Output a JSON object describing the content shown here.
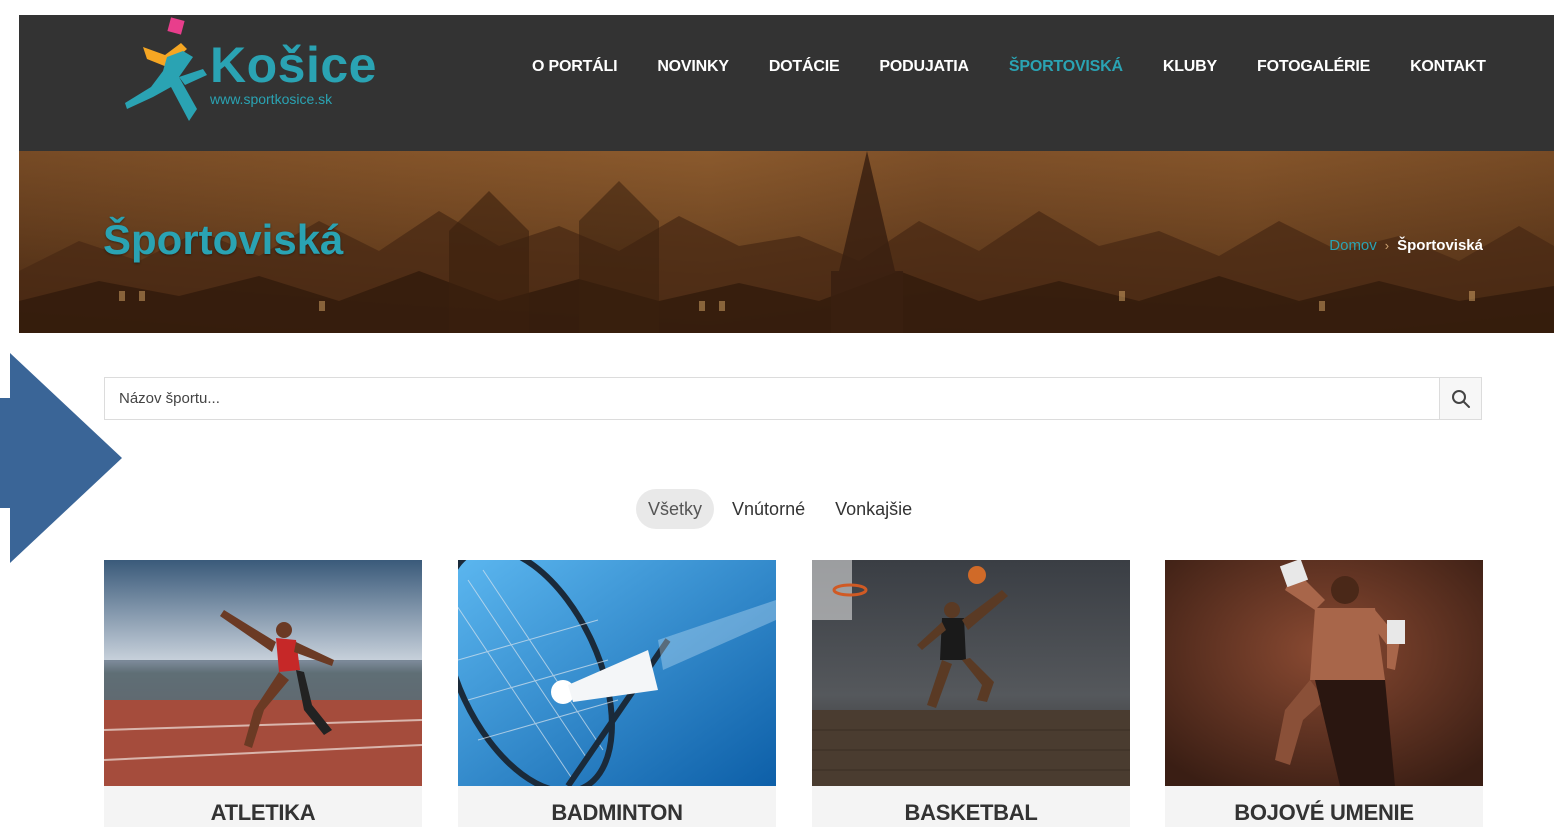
{
  "logo": {
    "brand": "Košice",
    "url": "www.sportkosice.sk",
    "brand_color": "#2aa3b3"
  },
  "nav": {
    "items": [
      {
        "label": "O PORTÁLI",
        "active": false
      },
      {
        "label": "NOVINKY",
        "active": false
      },
      {
        "label": "DOTÁCIE",
        "active": false
      },
      {
        "label": "PODUJATIA",
        "active": false
      },
      {
        "label": "ŠPORTOVISKÁ",
        "active": true
      },
      {
        "label": "KLUBY",
        "active": false
      },
      {
        "label": "FOTOGALÉRIE",
        "active": false
      },
      {
        "label": "KONTAKT",
        "active": false
      }
    ]
  },
  "banner": {
    "title": "Športoviská",
    "breadcrumb": {
      "home": "Domov",
      "current": "Športoviská"
    }
  },
  "search": {
    "placeholder": "Názov športu...",
    "value": "",
    "icon": "search-icon"
  },
  "filters": [
    {
      "label": "Všetky",
      "active": true
    },
    {
      "label": "Vnútorné",
      "active": false
    },
    {
      "label": "Vonkajšie",
      "active": false
    }
  ],
  "cards": [
    {
      "label": "ATLETIKA",
      "image": "sprinter-on-track"
    },
    {
      "label": "BADMINTON",
      "image": "badminton-racket-shuttlecock"
    },
    {
      "label": "BASKETBAL",
      "image": "basketball-dunk"
    },
    {
      "label": "BOJOVÉ UMENIE",
      "image": "martial-arts-fighter"
    }
  ],
  "colors": {
    "header_bg": "#333333",
    "accent": "#2aa3b3",
    "annotation_arrow": "#3a6597"
  }
}
